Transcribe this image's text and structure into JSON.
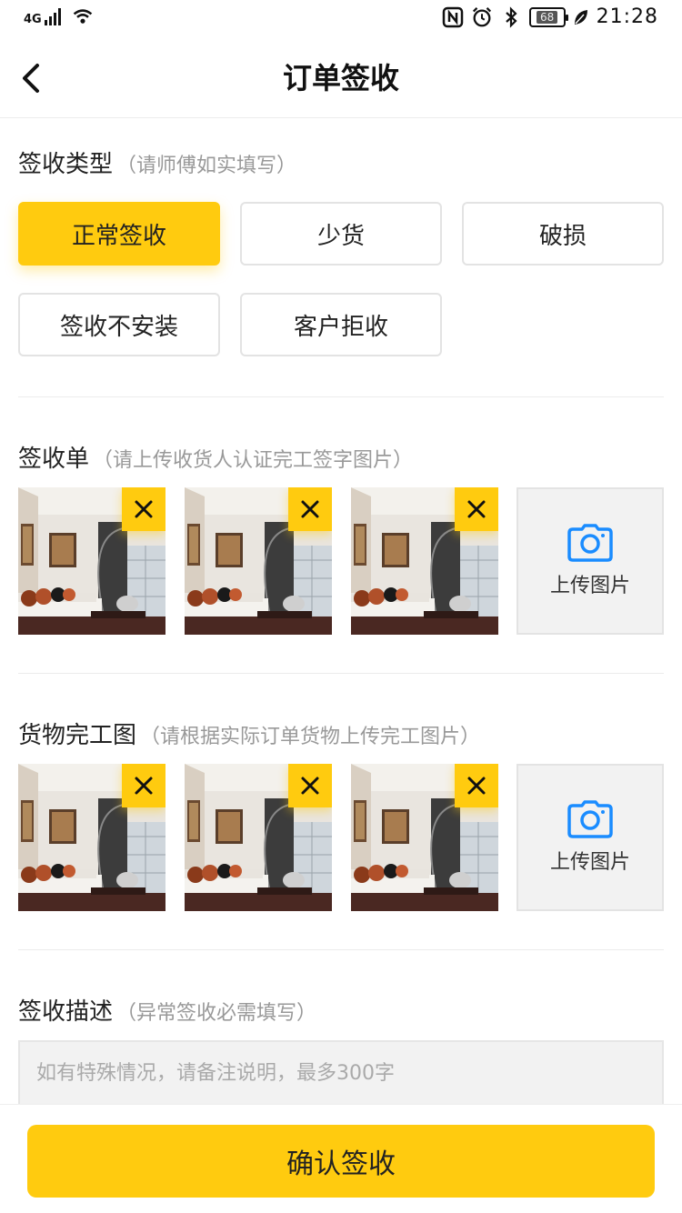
{
  "status_bar": {
    "network": "4G",
    "time": "21:28",
    "battery": "68"
  },
  "nav": {
    "title": "订单签收"
  },
  "sign_type": {
    "title": "签收类型",
    "hint": "（请师傅如实填写）",
    "options": [
      "正常签收",
      "少货",
      "破损",
      "签收不安装",
      "客户拒收"
    ],
    "selected": "正常签收"
  },
  "receipt": {
    "title": "签收单",
    "hint": "（请上传收货人认证完工签字图片）",
    "upload_label": "上传图片"
  },
  "goods": {
    "title": "货物完工图",
    "hint": "（请根据实际订单货物上传完工图片）",
    "upload_label": "上传图片"
  },
  "description": {
    "title": "签收描述",
    "hint": "（异常签收必需填写）",
    "placeholder": "如有特殊情况，请备注说明，最多300字"
  },
  "footer": {
    "confirm_label": "确认签收"
  },
  "colors": {
    "accent": "#ffcb0f",
    "upload_icon": "#1a8cff"
  }
}
